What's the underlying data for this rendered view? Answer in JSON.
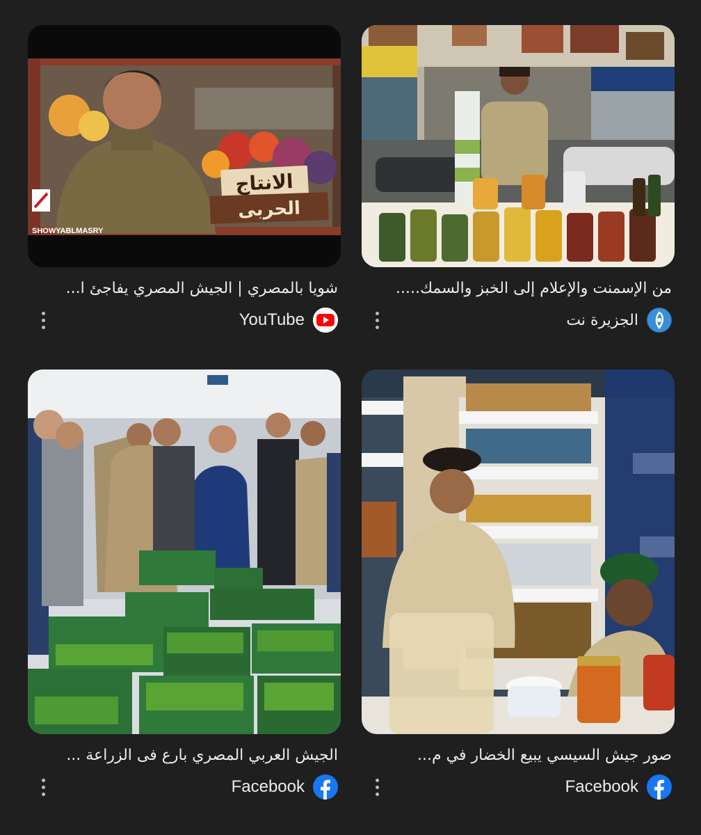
{
  "results": [
    {
      "title": "من الإسمنت والإعلام إلى الخبز والسمك.....",
      "source": "الجزيرة نت",
      "source_icon": "aljazeera-icon",
      "image_alt": "market-stall-photo"
    },
    {
      "title": "شويا بالمصري | الجيش المصري يفاجئ ا...",
      "source": "YouTube",
      "source_icon": "youtube-icon",
      "image_alt": "video-thumbnail",
      "thumbnail_text": {
        "line1": "الانتاج",
        "line2": "الحربى",
        "watermark": "SHOWYABLMASRY"
      }
    },
    {
      "title": "صور جيش السيسي يبيع الخضار في م...",
      "source": "Facebook",
      "source_icon": "facebook-icon",
      "image_alt": "shop-officers-photo"
    },
    {
      "title": "الجيش العربي المصري بارع فى الزراعة ...",
      "source": "Facebook",
      "source_icon": "facebook-icon",
      "image_alt": "vegetable-crates-photo"
    }
  ],
  "colors": {
    "background": "#1f1f1f",
    "youtube_red": "#ff0000",
    "facebook_blue": "#1877f2",
    "aljazeera_blue": "#3a8fd8"
  }
}
